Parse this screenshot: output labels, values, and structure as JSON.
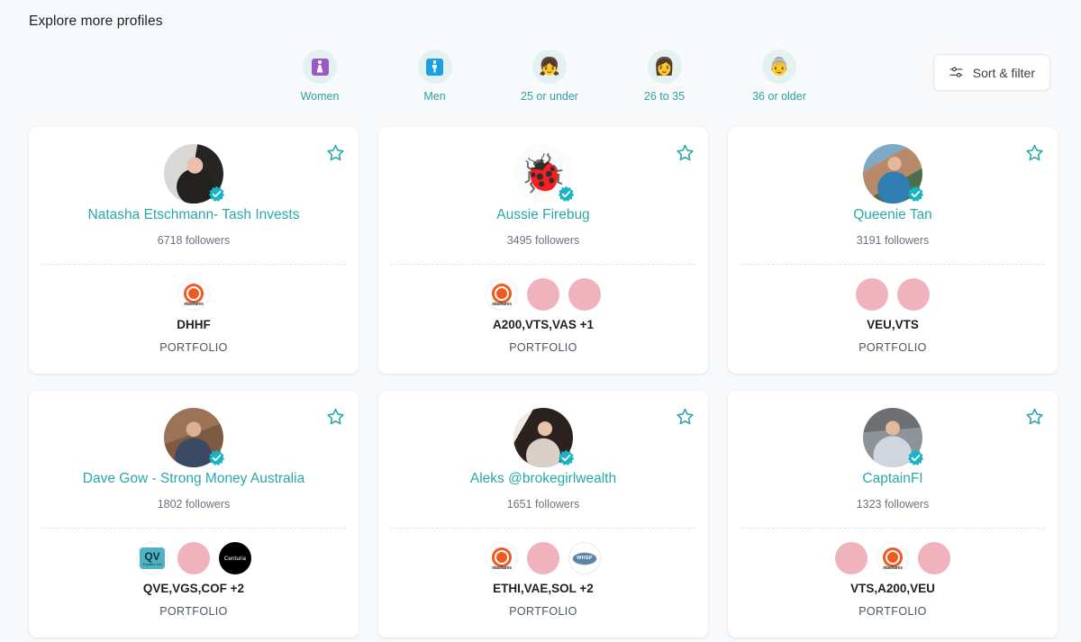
{
  "header": {
    "title": "Explore more profiles"
  },
  "filters": {
    "chips": [
      {
        "label": "Women",
        "icon": "women-restroom-icon",
        "glyph": ""
      },
      {
        "label": "Men",
        "icon": "men-restroom-icon",
        "glyph": ""
      },
      {
        "label": "25 or under",
        "icon": "girl-face-icon",
        "glyph": "👧"
      },
      {
        "label": "26 to 35",
        "icon": "woman-face-icon",
        "glyph": "👩"
      },
      {
        "label": "36 or older",
        "icon": "older-person-face-icon",
        "glyph": "👵"
      }
    ],
    "sort_filter_label": "Sort & filter"
  },
  "colors": {
    "accent_teal": "#2aa7a9",
    "chip_label": "#2f9fa3",
    "chip_bg": "#e3f2f1",
    "page_bg": "#f7f9fb",
    "card_bg": "#ffffff",
    "star": "#2aa7a9",
    "verified_badge": "#17b4c4",
    "blank_logo": "#f0b3bd"
  },
  "portfolio_label": "PORTFOLIO",
  "cards": [
    {
      "name": "Natasha Etschmann- Tash Invests",
      "followers": "6718 followers",
      "verified": true,
      "starred": false,
      "avatar_kind": "photo-natasha",
      "logos": [
        {
          "kind": "betashares",
          "text": "etashares"
        }
      ],
      "tickers": "DHHF"
    },
    {
      "name": "Aussie Firebug",
      "followers": "3495 followers",
      "verified": true,
      "starred": false,
      "avatar_kind": "emoji-firebug",
      "avatar_glyph": "🐞",
      "logos": [
        {
          "kind": "betashares",
          "text": "etashares"
        },
        {
          "kind": "blank"
        },
        {
          "kind": "blank"
        }
      ],
      "tickers": "A200,VTS,VAS +1"
    },
    {
      "name": "Queenie Tan",
      "followers": "3191 followers",
      "verified": true,
      "starred": false,
      "avatar_kind": "photo-queenie",
      "logos": [
        {
          "kind": "blank"
        },
        {
          "kind": "blank"
        }
      ],
      "tickers": "VEU,VTS"
    },
    {
      "name": "Dave Gow - Strong Money Australia",
      "followers": "1802 followers",
      "verified": true,
      "starred": false,
      "avatar_kind": "photo-dave",
      "logos": [
        {
          "kind": "qv",
          "text": "QV",
          "subtext": "Equities Ltd"
        },
        {
          "kind": "blank"
        },
        {
          "kind": "centuria",
          "text": "Centuria"
        }
      ],
      "tickers": "QVE,VGS,COF +2"
    },
    {
      "name": "Aleks @brokegirlwealth",
      "followers": "1651 followers",
      "verified": true,
      "starred": false,
      "avatar_kind": "photo-aleks",
      "logos": [
        {
          "kind": "betashares",
          "text": "etashares"
        },
        {
          "kind": "blank"
        },
        {
          "kind": "whsp",
          "text": "WHSP"
        }
      ],
      "tickers": "ETHI,VAE,SOL +2"
    },
    {
      "name": "CaptainFI",
      "followers": "1323 followers",
      "verified": true,
      "starred": false,
      "avatar_kind": "photo-captain",
      "logos": [
        {
          "kind": "blank"
        },
        {
          "kind": "betashares",
          "text": "etashares"
        },
        {
          "kind": "blank"
        }
      ],
      "tickers": "VTS,A200,VEU"
    }
  ]
}
